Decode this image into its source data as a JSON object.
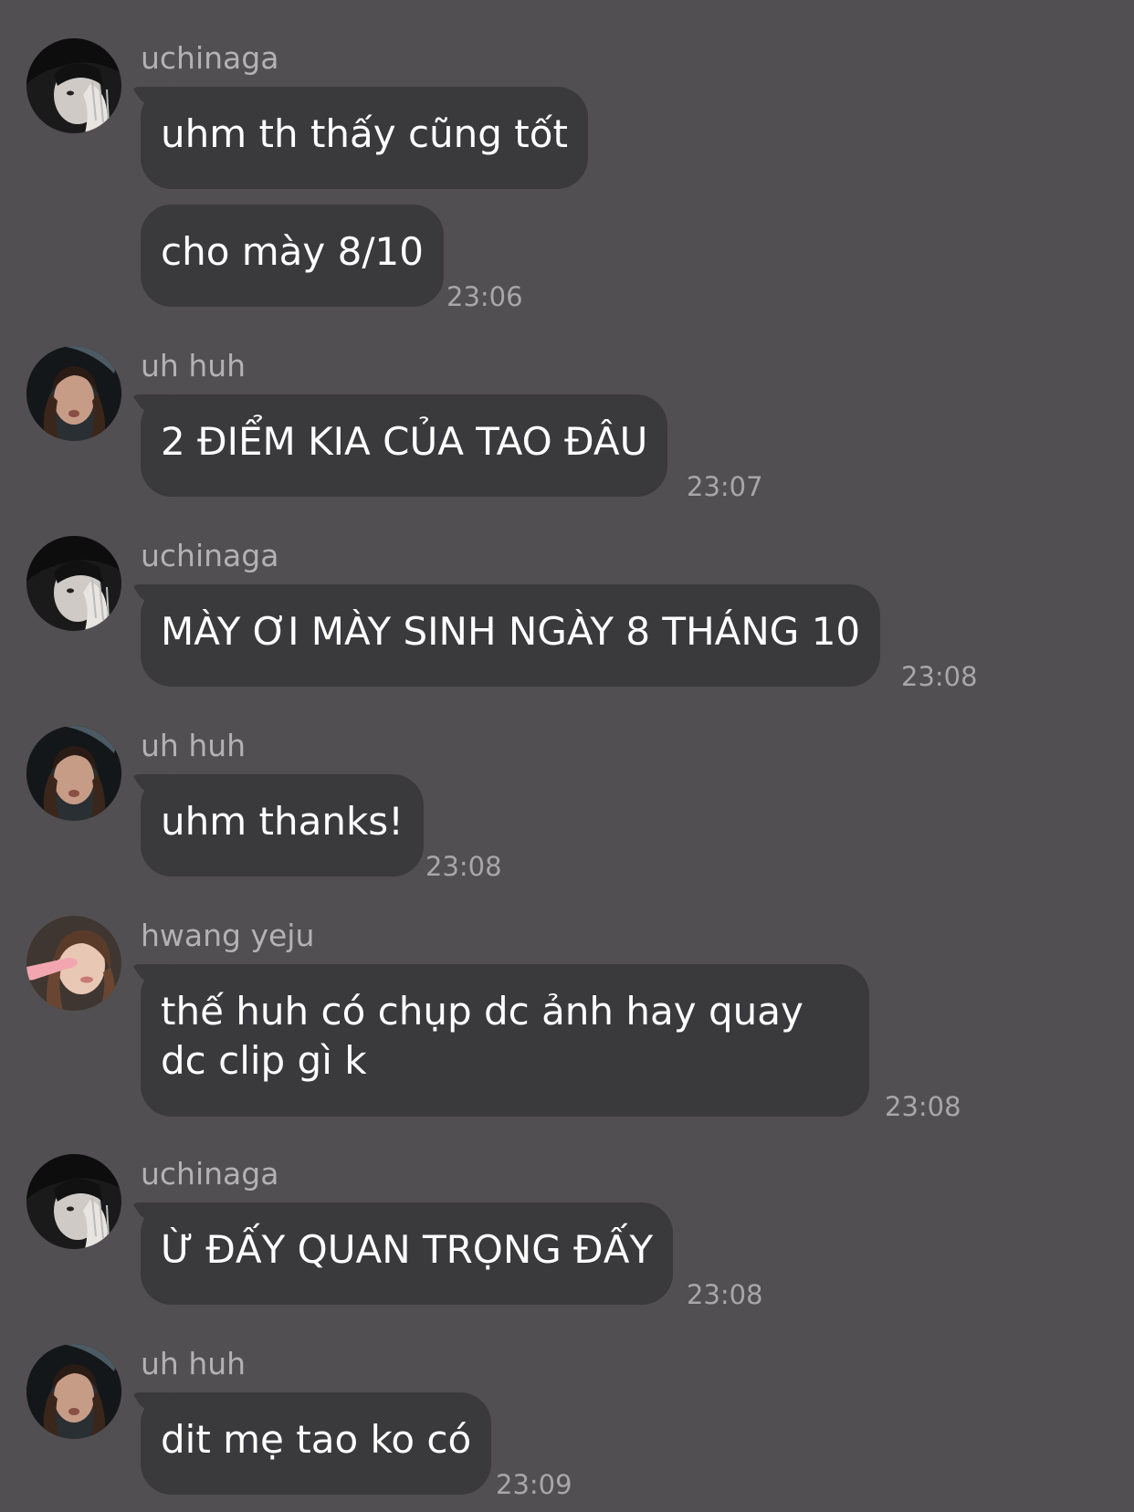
{
  "messages": [
    {
      "sender": "uchinaga",
      "avatar": "avatar-uchinaga",
      "bubbles": [
        "uhm th thấy cũng tốt",
        "cho mày 8/10"
      ],
      "time": "23:06"
    },
    {
      "sender": "uh huh",
      "avatar": "avatar-uh-huh",
      "bubbles": [
        "2 ĐIỂM KIA CỦA TAO ĐÂU"
      ],
      "time": "23:07"
    },
    {
      "sender": "uchinaga",
      "avatar": "avatar-uchinaga",
      "bubbles": [
        "MÀY ƠI MÀY SINH NGÀY 8 THÁNG 10"
      ],
      "time": "23:08"
    },
    {
      "sender": "uh huh",
      "avatar": "avatar-uh-huh",
      "bubbles": [
        "uhm thanks!"
      ],
      "time": "23:08"
    },
    {
      "sender": "hwang yeju",
      "avatar": "avatar-hwang-yeju",
      "bubbles": [
        "thế huh có chụp dc ảnh hay quay dc clip gì k"
      ],
      "time": "23:08"
    },
    {
      "sender": "uchinaga",
      "avatar": "avatar-uchinaga",
      "bubbles": [
        "Ừ ĐẤY QUAN TRỌNG ĐẤY"
      ],
      "time": "23:08"
    },
    {
      "sender": "uh huh",
      "avatar": "avatar-uh-huh",
      "bubbles": [
        "dit mẹ tao ko có"
      ],
      "time": "23:09"
    }
  ],
  "colors": {
    "background": "#514f51",
    "bubble": "#3a393b",
    "bubble_text": "#ffffff",
    "sender_text": "#b3b1b3",
    "time_text": "#a8a6a8"
  }
}
